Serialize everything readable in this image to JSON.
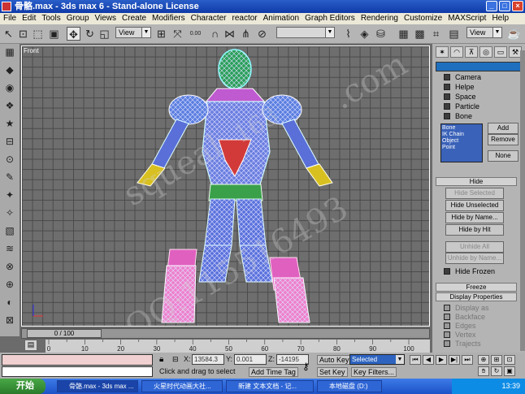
{
  "window": {
    "title": "骨骼.max - 3ds max 6 - Stand-alone License",
    "min": "_",
    "max": "□",
    "close": "×"
  },
  "menu": [
    "File",
    "Edit",
    "Tools",
    "Group",
    "Views",
    "Create",
    "Modifiers",
    "Character",
    "reactor",
    "Animation",
    "Graph Editors",
    "Rendering",
    "Customize",
    "MAXScript",
    "Help"
  ],
  "toolbar": {
    "view_dropdown": "View",
    "view_dropdown2": "View",
    "spinner_value": "0.00"
  },
  "viewport": {
    "label": "Front"
  },
  "watermark": {
    "line1": "squeal",
    "line2": "QQ:115516493",
    "line3": ".com",
    "line4": "163"
  },
  "command_panel": {
    "checkboxes": [
      "Camera",
      "Helpe",
      "Space",
      "Particle",
      "Bone"
    ],
    "list_items": [
      "Bone",
      "IK Chain Object",
      "Point"
    ],
    "add": "Add",
    "remove": "Remove",
    "none": "None",
    "hide_rollout": "Hide",
    "hide_selected": "Hide Selected",
    "hide_unselected": "Hide Unselected",
    "hide_by_name": "Hide by Name...",
    "hide_by_hit": "Hide by Hit",
    "unhide_all": "Unhide All",
    "unhide_by_name": "Unhide by Name...",
    "hide_frozen": "Hide Frozen",
    "freeze_rollout": "Freeze",
    "display_props_rollout": "Display Properties",
    "display_opts": [
      "Display as",
      "Backface",
      "Edges",
      "Vertex",
      "Trajects"
    ]
  },
  "timeline": {
    "slider": "0 / 100",
    "ticks": [
      "0",
      "10",
      "20",
      "30",
      "40",
      "50",
      "60",
      "70",
      "80",
      "90",
      "100"
    ]
  },
  "status": {
    "prompt": "Click and drag to select",
    "add_time_tag": "Add Time Tag",
    "x_label": "X:",
    "x_value": "13584.3",
    "y_label": "Y:",
    "y_value": "0.001",
    "z_label": "Z:",
    "z_value": "-14195",
    "auto_key": "Auto Key",
    "set_key": "Set Key",
    "selected": "Selected",
    "key_filters": "Key Filters..."
  },
  "taskbar": {
    "start": "开始",
    "tasks": [
      "骨骼.max - 3ds max ...",
      "火星时代动画大社...",
      "新建 文本文档 - 记...",
      "本地磁盘 (D:)"
    ],
    "clock": "13:39"
  }
}
